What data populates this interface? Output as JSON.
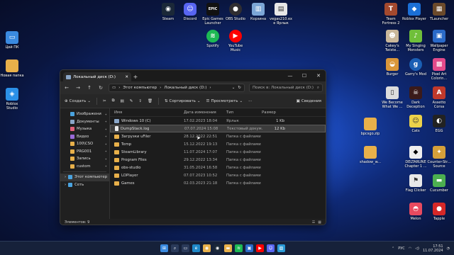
{
  "desktop_icons": {
    "steam": "Steam",
    "discord": "Discord",
    "epic": "Epic Games Launcher",
    "epic_logo": "EPIC",
    "obs": "OBS Studio",
    "trash": "Корзина",
    "vegas": "vegas210.exe Ярлык",
    "tf2": "Team Fortress 2",
    "roblox_player": "Roblox Player",
    "tlauncher": "TLauncher",
    "spotify": "Spotify",
    "youtube_music": "YouTube Music",
    "this_pc": "Цей ПК",
    "new_folder": "Новая папка",
    "roblox_studio": "Roblox Studio",
    "cakeys": "Cakey's Twiste...",
    "my_singing": "My Singing Monsters",
    "wallpaper": "Wallpaper Engine",
    "burger": "Burger",
    "garrys": "Garry's Mod",
    "pixel_art": "Pixel Art Colorin...",
    "we_become": "We Become What We ...",
    "dark_deception": "Dark Deception",
    "assetto": "Assetto Corsa",
    "cats": "Cats",
    "egg": "EGG",
    "bpcsgo": "bpcsgo.zip",
    "shadow": "shadow_w...",
    "deltarune": "DELTARUNE Chapter 1 ...",
    "csgo": "Counter-Str... Source",
    "flag_clicker": "Flag Clicker",
    "cucumber": "Cucumber",
    "melon": "Melon",
    "tapple": "Tapple"
  },
  "window": {
    "tab_title": "Локальный диск (D:)",
    "new_tab": "+",
    "minimize": "—",
    "maximize": "☐",
    "close": "✕",
    "breadcrumb": [
      "Этот компьютер",
      "Локальный диск (D:)"
    ],
    "search_placeholder": "Поиск в: Локальный диск (D:)",
    "toolbar": {
      "create": "Создать",
      "sort": "Сортировать",
      "view": "Просмотреть",
      "details": "Сведения"
    },
    "sidebar": [
      {
        "label": "Изображени",
        "color": "#4aa3df",
        "sel": false
      },
      {
        "label": "Документы",
        "color": "#8aa6c8",
        "sel": false
      },
      {
        "label": "Музыка",
        "color": "#e0607a",
        "sel": false
      },
      {
        "label": "Видео",
        "color": "#9a6ad8",
        "sel": false
      },
      {
        "label": "100\\CSO",
        "color": "#e8b04a",
        "sel": false
      },
      {
        "label": "PRG001",
        "color": "#e8b04a",
        "sel": false
      },
      {
        "label": "Запись",
        "color": "#e8b04a",
        "sel": false
      },
      {
        "label": "custom",
        "color": "#e8b04a",
        "sel": false
      }
    ],
    "sidebar_bottom": [
      {
        "label": "Этот компьютер",
        "color": "#4aa3df",
        "sel": true
      },
      {
        "label": "Сеть",
        "color": "#4aa3df",
        "sel": false
      }
    ],
    "columns": {
      "name": "Имя",
      "date": "Дата изменения",
      "type": "Тип",
      "size": "Размер"
    },
    "files": [
      {
        "name": "Windows 10 (C)",
        "date": "17.02.2023 18:04",
        "type": "Ярлык",
        "size": "1 Kb",
        "icon": "drive",
        "sel": false
      },
      {
        "name": "DumpStack.log",
        "date": "07.07.2024 15:08",
        "type": "Текстовый докум...",
        "size": "12 Kb",
        "icon": "txt",
        "sel": true
      },
      {
        "name": "Загрузки uFiler",
        "date": "28.12.2022 22:51",
        "type": "Папка с файлами",
        "size": "",
        "icon": "fold",
        "sel": false
      },
      {
        "name": "Temp",
        "date": "15.12.2022 19:13",
        "type": "Папка с файлами",
        "size": "",
        "icon": "fold",
        "sel": false
      },
      {
        "name": "SteamLibrary",
        "date": "11.07.2024 17:07",
        "type": "Папка с файлами",
        "size": "",
        "icon": "fold",
        "sel": false
      },
      {
        "name": "Program Files",
        "date": "29.12.2022 13:34",
        "type": "Папка с файлами",
        "size": "",
        "icon": "fold",
        "sel": false
      },
      {
        "name": "obs-studio",
        "date": "31.05.2024 16:58",
        "type": "Папка с файлами",
        "size": "",
        "icon": "fold",
        "sel": false
      },
      {
        "name": "LDPlayer",
        "date": "07.07.2023 10:52",
        "type": "Папка с файлами",
        "size": "",
        "icon": "fold",
        "sel": false
      },
      {
        "name": "Games",
        "date": "02.03.2023 21:18",
        "type": "Папка с файлами",
        "size": "",
        "icon": "fold",
        "sel": false
      }
    ],
    "status": "Элементов: 9"
  },
  "taskbar": {
    "lang": "РУС",
    "time": "17:51",
    "date": "11.07.2024"
  }
}
